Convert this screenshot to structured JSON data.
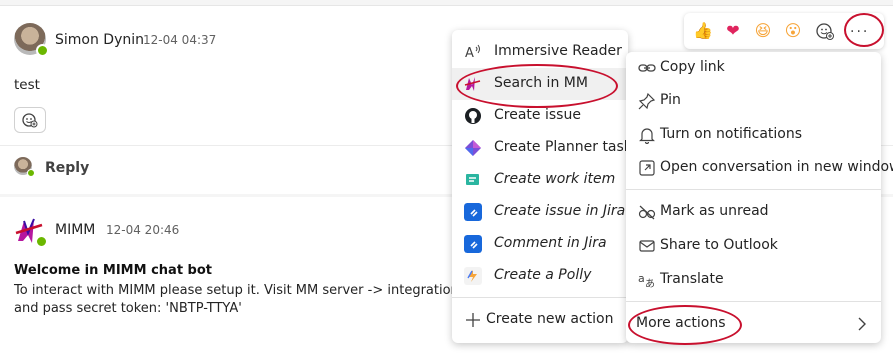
{
  "post1": {
    "author": "Simon Dynin",
    "time": "12-04 04:37",
    "message": "test",
    "reply_label": "Reply"
  },
  "post2": {
    "author": "MIMM",
    "time": "12-04 20:46",
    "title": "Welcome in MIMM chat bot",
    "line1": "To interact with MIMM please setup it. Visit MM server -> integrations -",
    "line2": "and pass secret token: 'NBTP-TTYA'"
  },
  "reactions": {
    "items": [
      {
        "name": "like",
        "glyph": "👍"
      },
      {
        "name": "heart",
        "glyph": "❤"
      },
      {
        "name": "laugh",
        "glyph": "😆"
      },
      {
        "name": "surprised",
        "glyph": "😮"
      }
    ],
    "more_glyph": "···"
  },
  "left_menu": {
    "items": [
      {
        "label": "Immersive Reader",
        "icon": "immersive-reader-icon",
        "italic": false
      },
      {
        "label": "Search in MM",
        "icon": "mm-logo-icon",
        "italic": false
      },
      {
        "label": "Create issue",
        "icon": "github-icon",
        "italic": false
      },
      {
        "label": "Create Planner task",
        "icon": "planner-icon",
        "italic": false
      },
      {
        "label": "Create work item",
        "icon": "work-item-icon",
        "italic": true
      },
      {
        "label": "Create issue in Jira",
        "icon": "jira-icon",
        "italic": true
      },
      {
        "label": "Comment in Jira",
        "icon": "jira-icon",
        "italic": true
      },
      {
        "label": "Create a Polly",
        "icon": "polly-icon",
        "italic": true
      }
    ],
    "footer": "Create new action"
  },
  "right_menu": {
    "items": [
      {
        "label": "Copy link",
        "icon": "link-icon"
      },
      {
        "label": "Pin",
        "icon": "pin-icon"
      },
      {
        "label": "Turn on notifications",
        "icon": "bell-icon"
      },
      {
        "label": "Open conversation in new window",
        "icon": "popout-icon"
      },
      {
        "label": "Mark as unread",
        "icon": "unread-icon"
      },
      {
        "label": "Share to Outlook",
        "icon": "mail-icon"
      },
      {
        "label": "Translate",
        "icon": "translate-icon"
      }
    ],
    "more_actions": "More actions"
  },
  "colors": {
    "presence": "#6bb700",
    "annotation": "#c8102e",
    "jira": "#1868db"
  }
}
